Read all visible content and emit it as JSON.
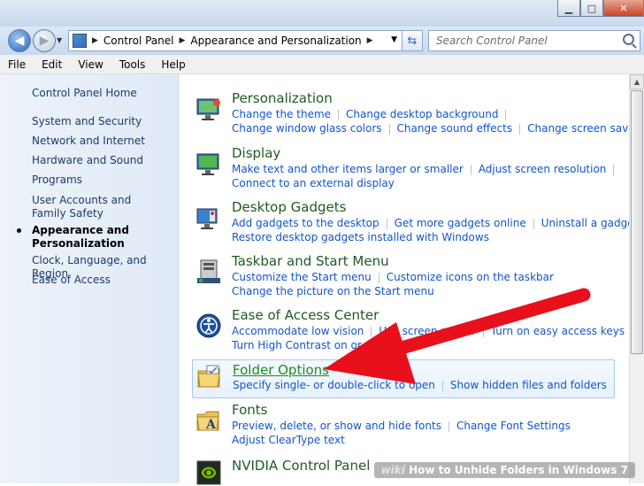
{
  "address": {
    "crumbs": [
      "Control Panel",
      "Appearance and Personalization"
    ],
    "search_placeholder": "Search Control Panel"
  },
  "menu": [
    "File",
    "Edit",
    "View",
    "Tools",
    "Help"
  ],
  "leftnav": {
    "home": "Control Panel Home",
    "items": [
      "System and Security",
      "Network and Internet",
      "Hardware and Sound",
      "Programs",
      "User Accounts and Family Safety",
      "Appearance and Personalization",
      "Clock, Language, and Region",
      "Ease of Access"
    ],
    "current_index": 5
  },
  "categories": [
    {
      "title": "Personalization",
      "icon": "personalization-icon",
      "links": [
        [
          "Change the theme",
          "Change desktop background"
        ],
        [
          "Change window glass colors",
          "Change sound effects",
          "Change screen saver"
        ]
      ]
    },
    {
      "title": "Display",
      "icon": "display-icon",
      "links": [
        [
          "Make text and other items larger or smaller",
          "Adjust screen resolution"
        ],
        [
          "Connect to an external display"
        ]
      ]
    },
    {
      "title": "Desktop Gadgets",
      "icon": "gadgets-icon",
      "links": [
        [
          "Add gadgets to the desktop",
          "Get more gadgets online",
          "Uninstall a gadget"
        ],
        [
          "Restore desktop gadgets installed with Windows"
        ]
      ]
    },
    {
      "title": "Taskbar and Start Menu",
      "icon": "taskbar-icon",
      "links": [
        [
          "Customize the Start menu",
          "Customize icons on the taskbar"
        ],
        [
          "Change the picture on the Start menu"
        ]
      ]
    },
    {
      "title": "Ease of Access Center",
      "icon": "ease-of-access-icon",
      "links": [
        [
          "Accommodate low vision",
          "Use screen reader",
          "Turn on easy access keys"
        ],
        [
          "Turn High Contrast on or off"
        ]
      ]
    },
    {
      "title": "Folder Options",
      "icon": "folder-options-icon",
      "links": [
        [
          "Specify single- or double-click to open",
          "Show hidden files and folders"
        ]
      ]
    },
    {
      "title": "Fonts",
      "icon": "fonts-icon",
      "links": [
        [
          "Preview, delete, or show and hide fonts",
          "Change Font Settings"
        ],
        [
          "Adjust ClearType text"
        ]
      ]
    },
    {
      "title": "NVIDIA Control Panel",
      "icon": "nvidia-icon",
      "links": []
    }
  ],
  "watermark": {
    "brand": "wiki",
    "text": "How to Unhide Folders in Windows 7"
  },
  "colors": {
    "link": "#1155cc",
    "title_green": "#1e5b22",
    "arrow_red": "#e8101a"
  }
}
